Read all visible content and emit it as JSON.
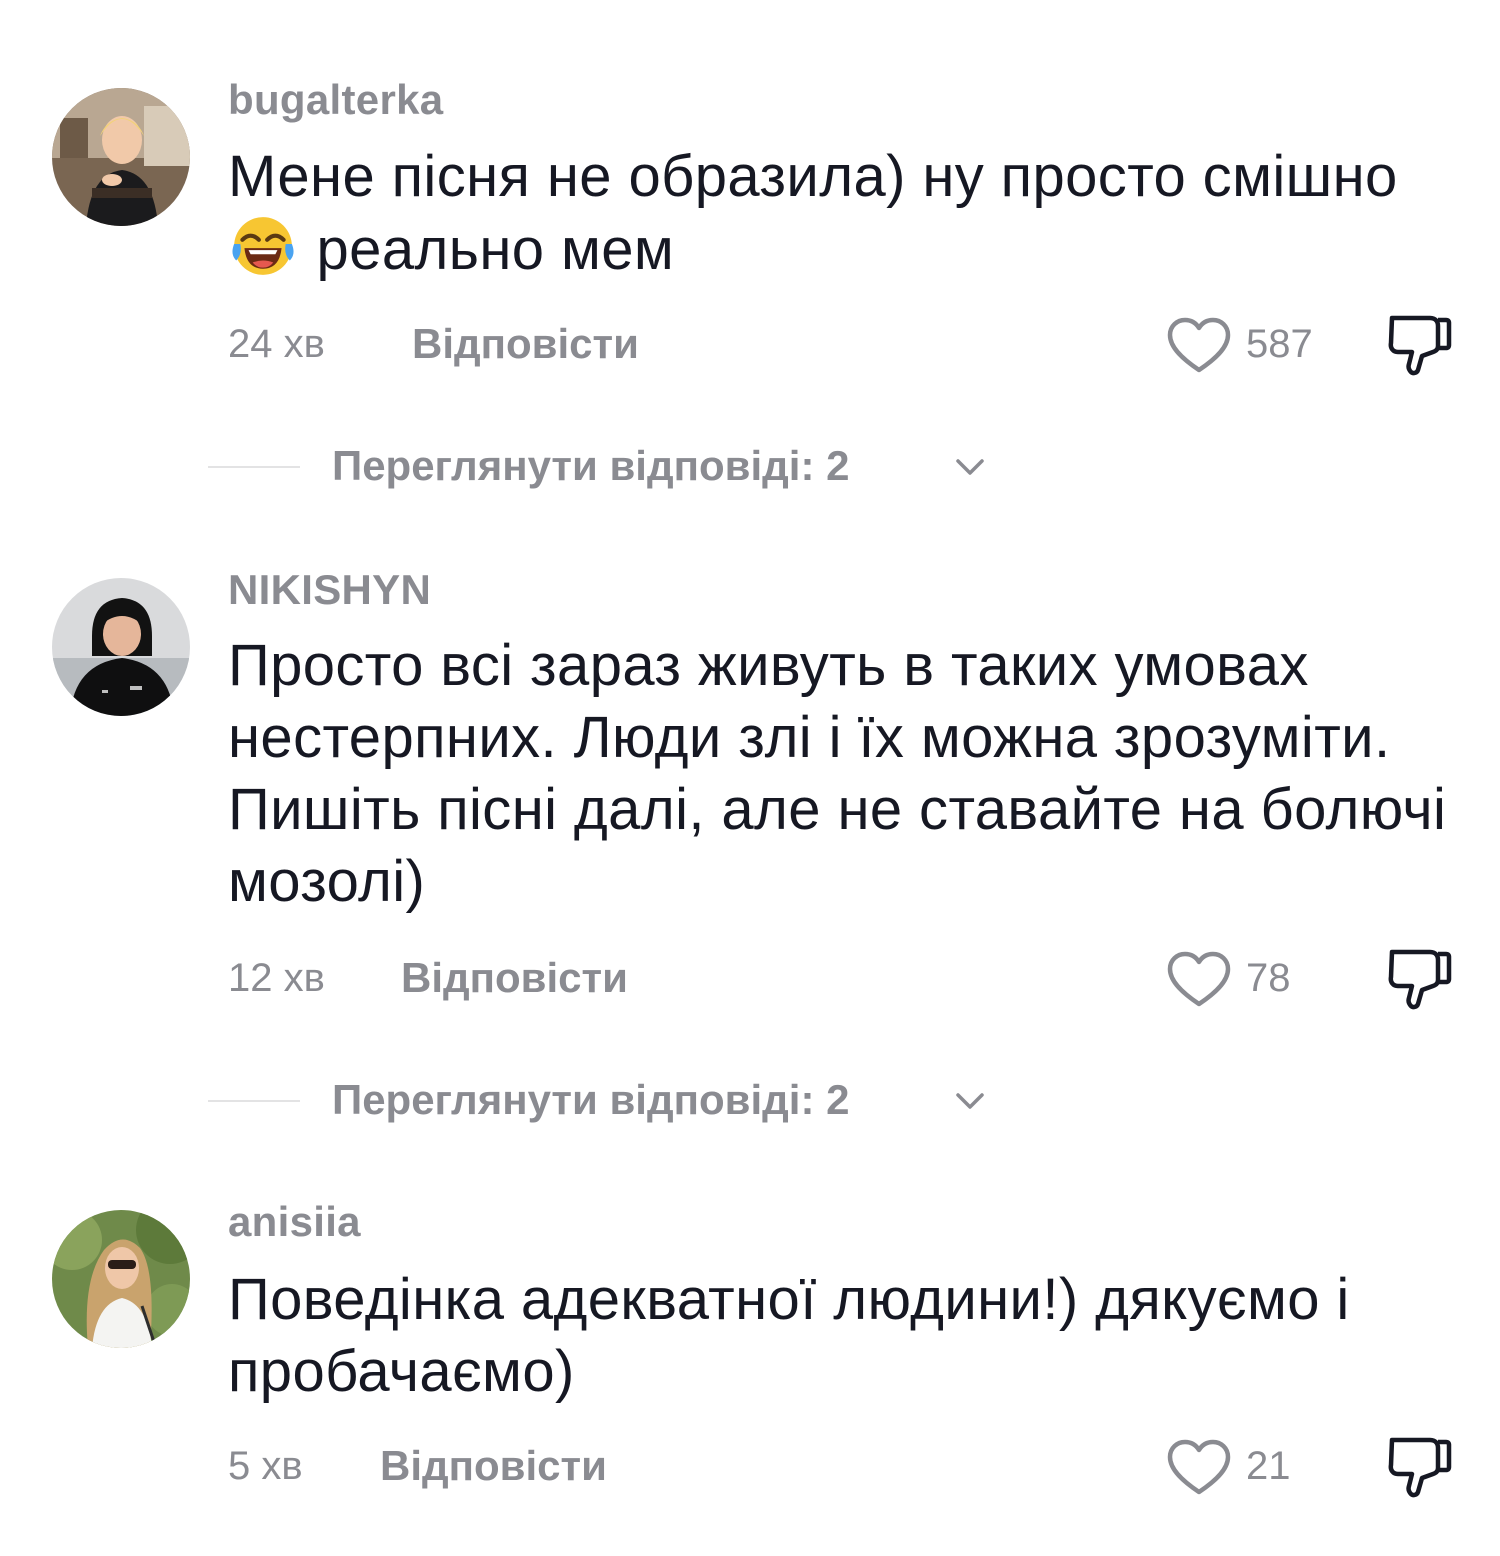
{
  "comments": [
    {
      "username": "bugalterka",
      "text_before_emoji": "Мене пісня не образила) ну просто смішно",
      "emoji": "face-with-tears-of-joy",
      "text_after_emoji": " реально мем",
      "time": "24 хв",
      "reply_label": "Відповісти",
      "likes": "587",
      "view_replies": "Переглянути відповіді: 2"
    },
    {
      "username": "NIKISHYN",
      "text": "Просто всі зараз живуть в таких умовах нестерпних. Люди злі і їх можна зрозуміти. Пишіть пісні далі, але не ставайте на болючі мозолі)",
      "time": "12 хв",
      "reply_label": "Відповісти",
      "likes": "78",
      "view_replies": "Переглянути відповіді: 2"
    },
    {
      "username": "anisiia",
      "text": "Поведінка адекватної людини!) дякуємо і пробачаємо)",
      "time": "5 хв",
      "reply_label": "Відповісти",
      "likes": "21"
    }
  ],
  "icons": {
    "like": "heart-outline-icon",
    "dislike": "thumbs-down-outline-icon",
    "expand": "chevron-down-icon"
  },
  "colors": {
    "text": "#161823",
    "secondary": "#8a8b91",
    "divider": "#e3e3e4"
  }
}
